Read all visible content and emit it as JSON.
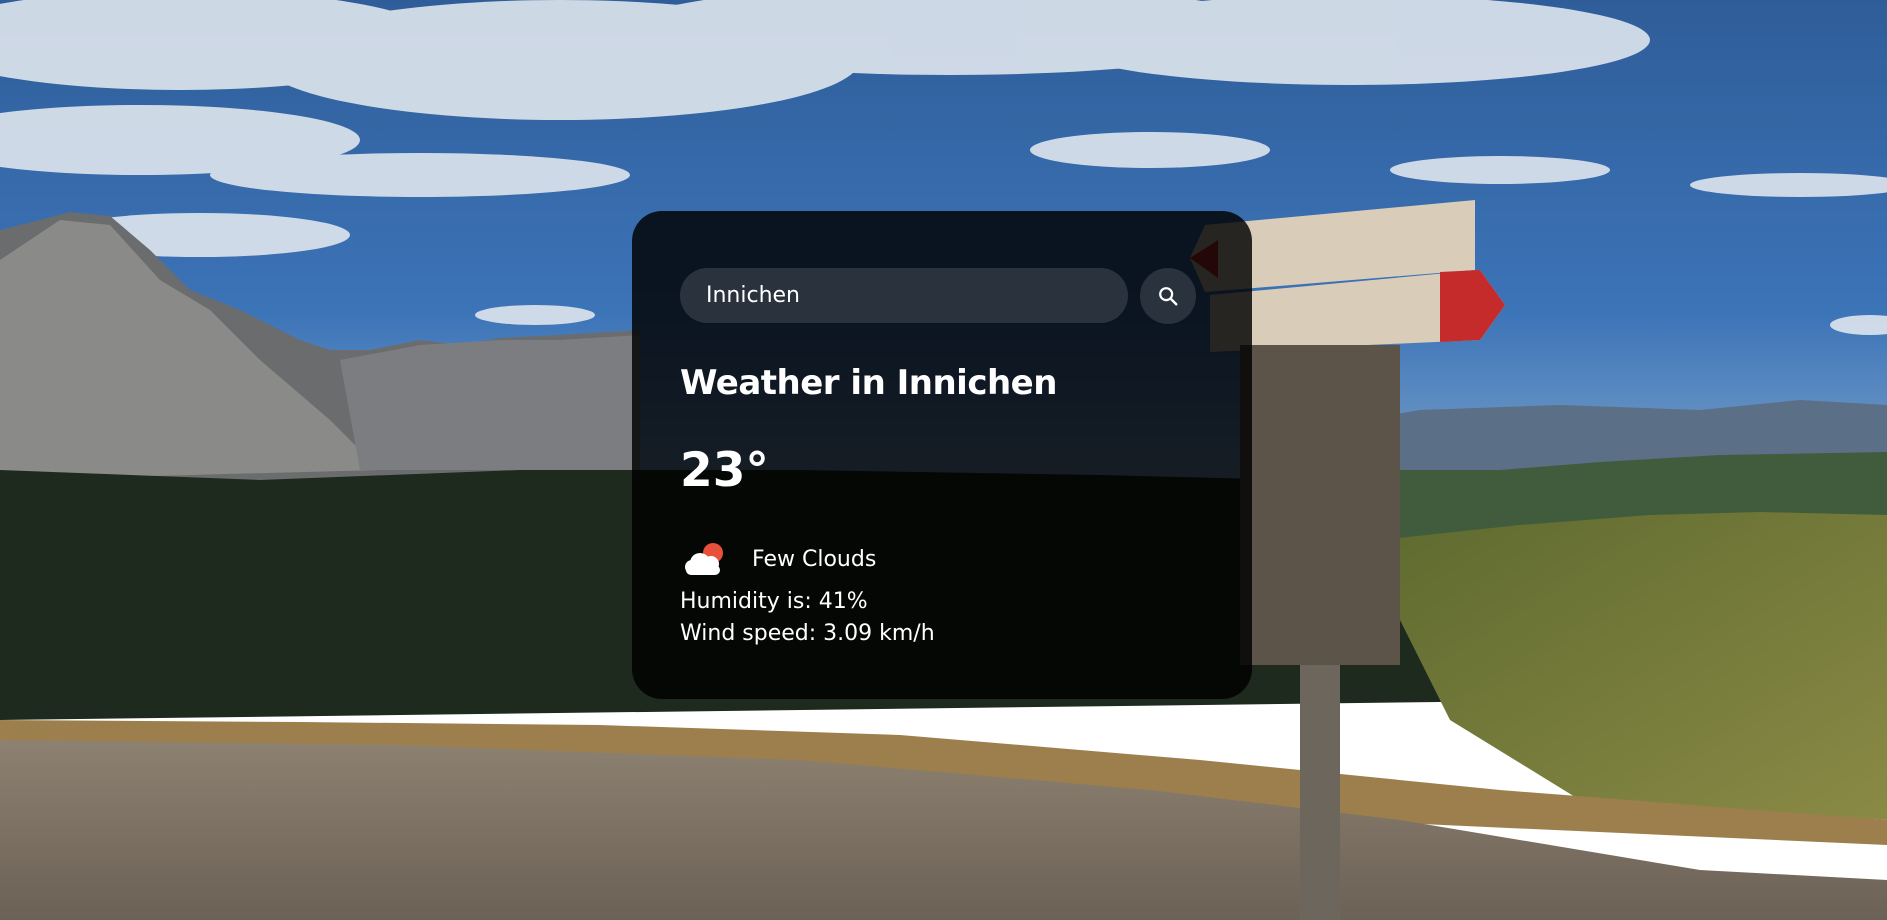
{
  "search": {
    "value": "Innichen",
    "button_icon": "search-icon"
  },
  "weather": {
    "title": "Weather in Innichen",
    "temperature": "23°",
    "condition_icon": "few-clouds-icon",
    "description": "Few Clouds",
    "humidity": "Humidity is: 41%",
    "wind": "Wind speed: 3.09 km/h"
  },
  "colors": {
    "card_background": "#000000",
    "text": "#ffffff",
    "sun": "#e8503a"
  }
}
